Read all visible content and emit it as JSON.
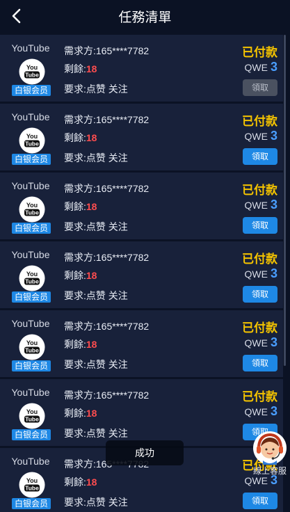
{
  "header": {
    "title": "任務清單"
  },
  "tasks": [
    {
      "platform": "YouTube",
      "level": "白银会员",
      "requester_label": "需求方:",
      "requester": "165****7782",
      "remaining_label": "剩餘:",
      "remaining": "18",
      "demand_label": "要求:",
      "demand": "点赞 关注",
      "status": "已付款",
      "currency": "QWE",
      "reward": "3",
      "button": "領取",
      "button_enabled": false
    },
    {
      "platform": "YouTube",
      "level": "白银会员",
      "requester_label": "需求方:",
      "requester": "165****7782",
      "remaining_label": "剩餘:",
      "remaining": "18",
      "demand_label": "要求:",
      "demand": "点赞 关注",
      "status": "已付款",
      "currency": "QWE",
      "reward": "3",
      "button": "領取",
      "button_enabled": true
    },
    {
      "platform": "YouTube",
      "level": "白银会员",
      "requester_label": "需求方:",
      "requester": "165****7782",
      "remaining_label": "剩餘:",
      "remaining": "18",
      "demand_label": "要求:",
      "demand": "点赞 关注",
      "status": "已付款",
      "currency": "QWE",
      "reward": "3",
      "button": "領取",
      "button_enabled": true
    },
    {
      "platform": "YouTube",
      "level": "白银会员",
      "requester_label": "需求方:",
      "requester": "165****7782",
      "remaining_label": "剩餘:",
      "remaining": "18",
      "demand_label": "要求:",
      "demand": "点赞 关注",
      "status": "已付款",
      "currency": "QWE",
      "reward": "3",
      "button": "領取",
      "button_enabled": true
    },
    {
      "platform": "YouTube",
      "level": "白银会员",
      "requester_label": "需求方:",
      "requester": "165****7782",
      "remaining_label": "剩餘:",
      "remaining": "18",
      "demand_label": "要求:",
      "demand": "点赞 关注",
      "status": "已付款",
      "currency": "QWE",
      "reward": "3",
      "button": "領取",
      "button_enabled": true
    },
    {
      "platform": "YouTube",
      "level": "白银会员",
      "requester_label": "需求方:",
      "requester": "165****7782",
      "remaining_label": "剩餘:",
      "remaining": "18",
      "demand_label": "要求:",
      "demand": "点赞 关注",
      "status": "已付款",
      "currency": "QWE",
      "reward": "3",
      "button": "領取",
      "button_enabled": true
    },
    {
      "platform": "YouTube",
      "level": "白银会员",
      "requester_label": "需求方:",
      "requester": "165****7782",
      "remaining_label": "剩餘:",
      "remaining": "18",
      "demand_label": "要求:",
      "demand": "点赞 关注",
      "status": "已付款",
      "currency": "QWE",
      "reward": "3",
      "button": "領取",
      "button_enabled": true
    }
  ],
  "toast": {
    "text": "成功"
  },
  "customer_service": {
    "label": "線上客服",
    "icon": "customer-service-icon"
  },
  "colors": {
    "background": "#0b1224",
    "row": "#18213a",
    "accent": "#1e88e5",
    "paid": "#f5c400",
    "remaining": "#ff4d4f",
    "reward": "#4a9eff"
  },
  "icons": {
    "back": "chevron-left-icon",
    "logo": "youtube-icon"
  }
}
